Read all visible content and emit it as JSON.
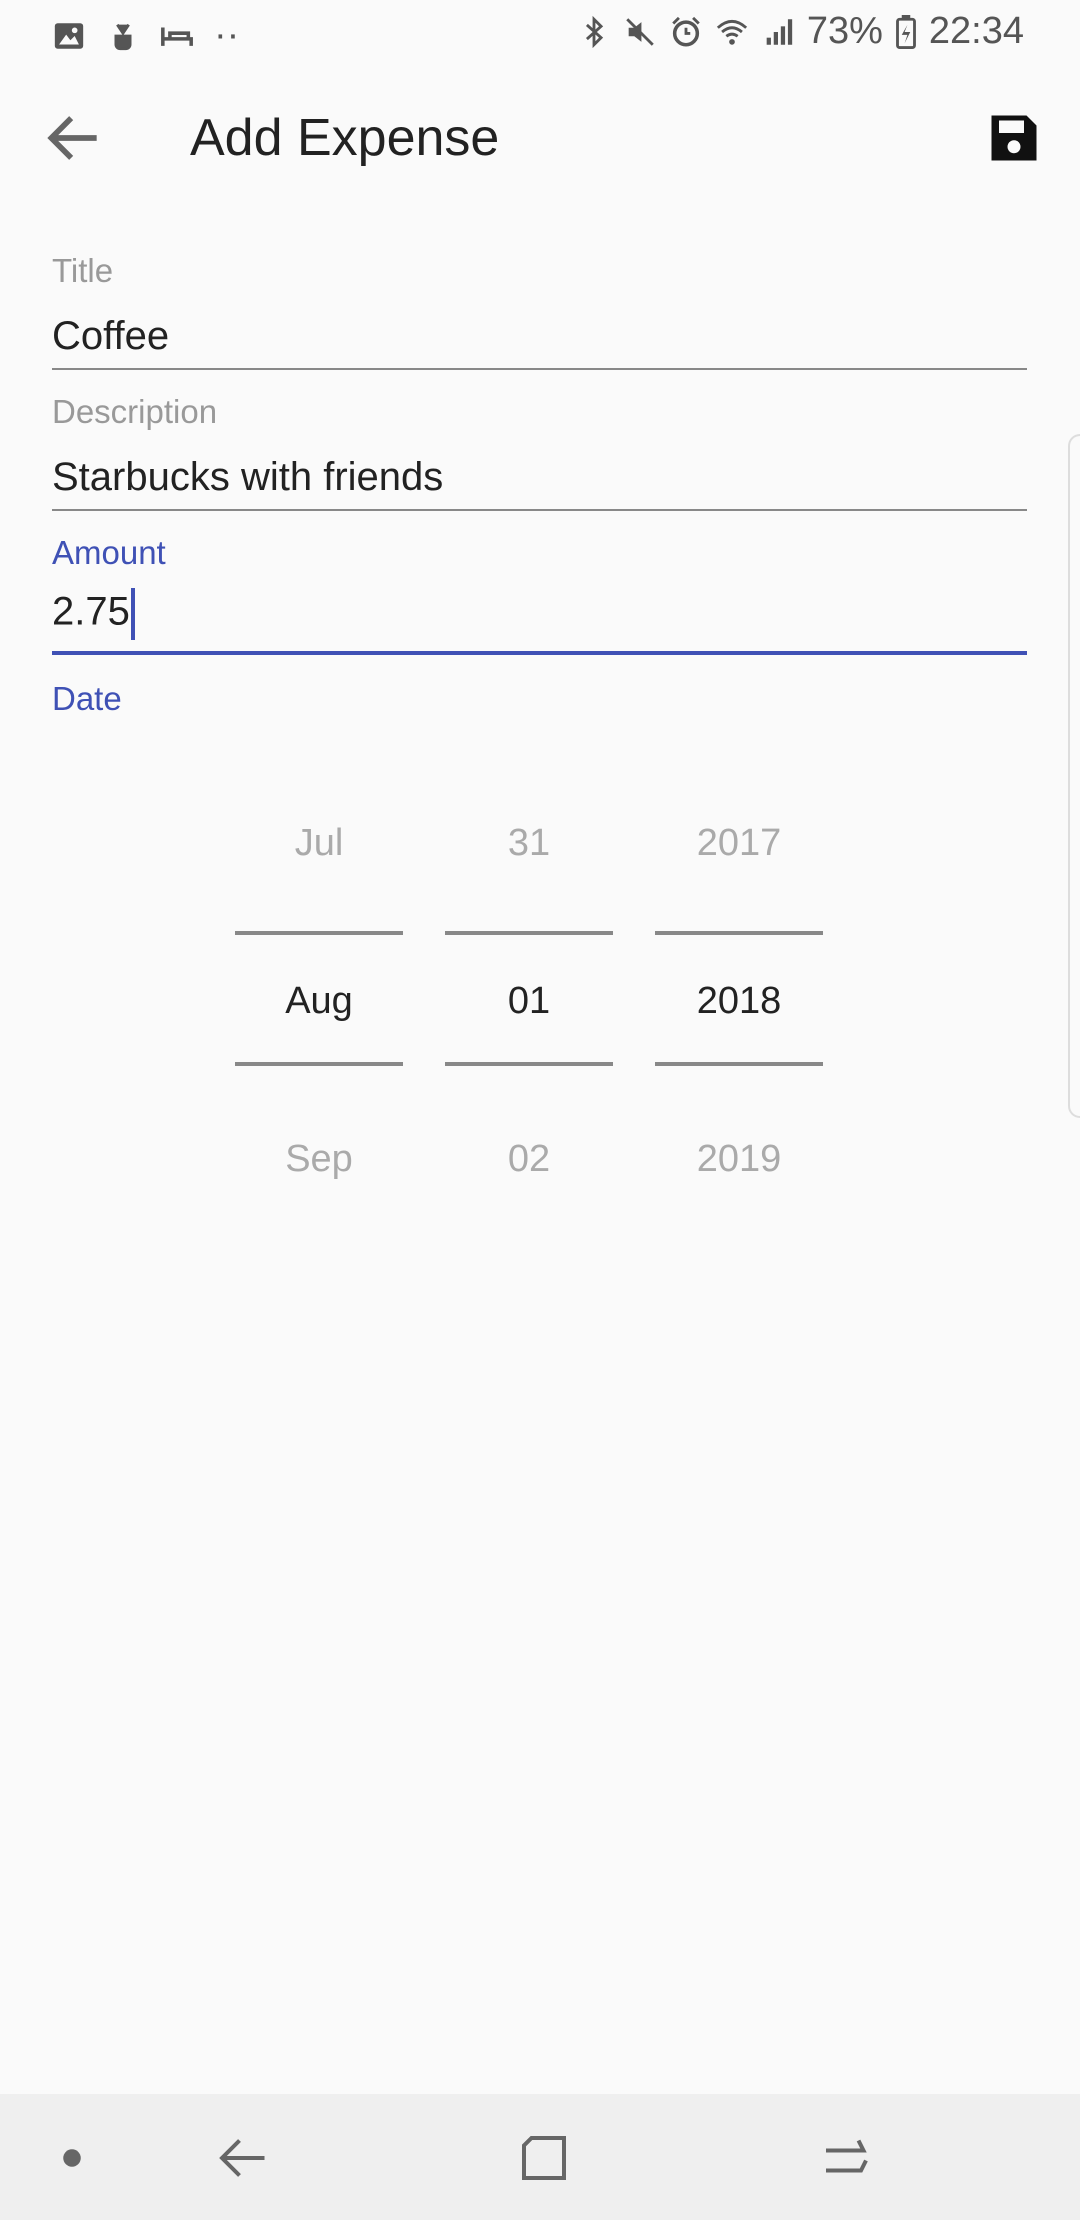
{
  "status_bar": {
    "battery": "73%",
    "time": "22:34"
  },
  "app_bar": {
    "title": "Add Expense"
  },
  "form": {
    "title_field": {
      "label": "Title",
      "value": "Coffee"
    },
    "description_field": {
      "label": "Description",
      "value": "Starbucks with friends"
    },
    "amount_field": {
      "label": "Amount",
      "value": "2.75"
    },
    "date_label": "Date"
  },
  "date_picker": {
    "month": {
      "prev": "Jul",
      "selected": "Aug",
      "next": "Sep"
    },
    "day": {
      "prev": "31",
      "selected": "01",
      "next": "02"
    },
    "year": {
      "prev": "2017",
      "selected": "2018",
      "next": "2019"
    }
  },
  "colors": {
    "accent": "#3f51b5",
    "background": "#fafafa",
    "nav_background": "#efefef"
  }
}
